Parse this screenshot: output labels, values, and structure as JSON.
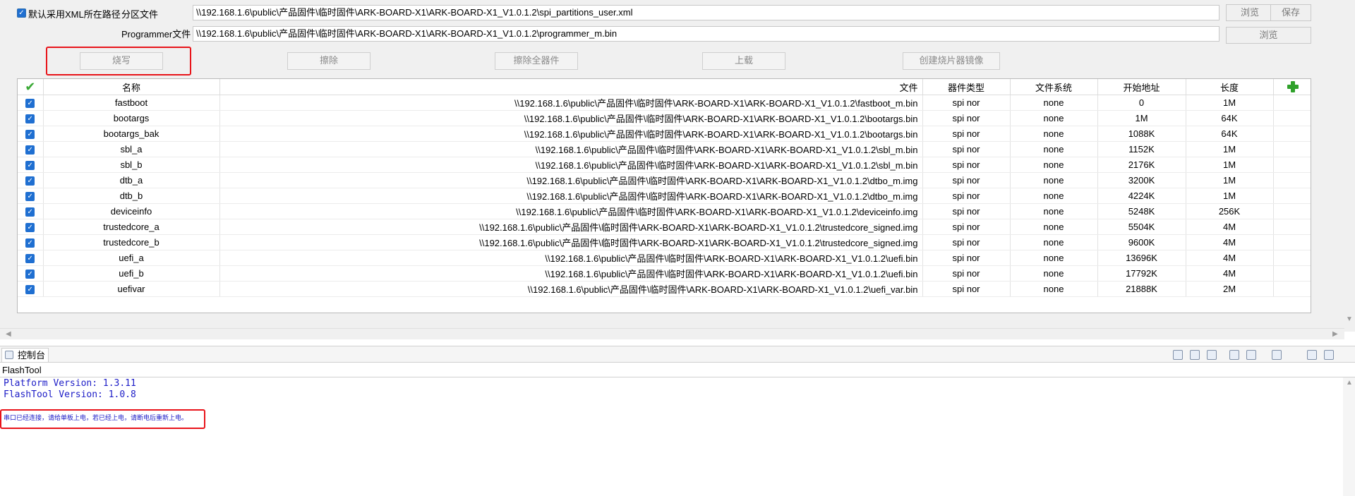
{
  "config": {
    "use_xml_path_label": "默认采用XML所在路径",
    "partition_label": "分区文件",
    "partition_path": "\\\\192.168.1.6\\public\\产品固件\\临时固件\\ARK-BOARD-X1\\ARK-BOARD-X1_V1.0.1.2\\spi_partitions_user.xml",
    "programmer_label": "Programmer文件",
    "programmer_path": "\\\\192.168.1.6\\public\\产品固件\\临时固件\\ARK-BOARD-X1\\ARK-BOARD-X1_V1.0.1.2\\programmer_m.bin",
    "browse_label": "浏览",
    "save_label": "保存",
    "browse2_label": "浏览"
  },
  "actions": {
    "flash": "烧写",
    "erase": "擦除",
    "erase_all": "擦除全器件",
    "upload": "上载",
    "create_image": "创建烧片器镜像"
  },
  "table": {
    "headers": {
      "name": "名称",
      "file": "文件",
      "device_type": "器件类型",
      "filesystem": "文件系统",
      "start_addr": "开始地址",
      "length": "长度"
    },
    "rows": [
      {
        "name": "fastboot",
        "file": "\\\\192.168.1.6\\public\\产品固件\\临时固件\\ARK-BOARD-X1\\ARK-BOARD-X1_V1.0.1.2\\fastboot_m.bin",
        "type": "spi nor",
        "fs": "none",
        "start": "0",
        "len": "1M"
      },
      {
        "name": "bootargs",
        "file": "\\\\192.168.1.6\\public\\产品固件\\临时固件\\ARK-BOARD-X1\\ARK-BOARD-X1_V1.0.1.2\\bootargs.bin",
        "type": "spi nor",
        "fs": "none",
        "start": "1M",
        "len": "64K"
      },
      {
        "name": "bootargs_bak",
        "file": "\\\\192.168.1.6\\public\\产品固件\\临时固件\\ARK-BOARD-X1\\ARK-BOARD-X1_V1.0.1.2\\bootargs.bin",
        "type": "spi nor",
        "fs": "none",
        "start": "1088K",
        "len": "64K"
      },
      {
        "name": "sbl_a",
        "file": "\\\\192.168.1.6\\public\\产品固件\\临时固件\\ARK-BOARD-X1\\ARK-BOARD-X1_V1.0.1.2\\sbl_m.bin",
        "type": "spi nor",
        "fs": "none",
        "start": "1152K",
        "len": "1M"
      },
      {
        "name": "sbl_b",
        "file": "\\\\192.168.1.6\\public\\产品固件\\临时固件\\ARK-BOARD-X1\\ARK-BOARD-X1_V1.0.1.2\\sbl_m.bin",
        "type": "spi nor",
        "fs": "none",
        "start": "2176K",
        "len": "1M"
      },
      {
        "name": "dtb_a",
        "file": "\\\\192.168.1.6\\public\\产品固件\\临时固件\\ARK-BOARD-X1\\ARK-BOARD-X1_V1.0.1.2\\dtbo_m.img",
        "type": "spi nor",
        "fs": "none",
        "start": "3200K",
        "len": "1M"
      },
      {
        "name": "dtb_b",
        "file": "\\\\192.168.1.6\\public\\产品固件\\临时固件\\ARK-BOARD-X1\\ARK-BOARD-X1_V1.0.1.2\\dtbo_m.img",
        "type": "spi nor",
        "fs": "none",
        "start": "4224K",
        "len": "1M"
      },
      {
        "name": "deviceinfo",
        "file": "\\\\192.168.1.6\\public\\产品固件\\临时固件\\ARK-BOARD-X1\\ARK-BOARD-X1_V1.0.1.2\\deviceinfo.img",
        "type": "spi nor",
        "fs": "none",
        "start": "5248K",
        "len": "256K"
      },
      {
        "name": "trustedcore_a",
        "file": "\\\\192.168.1.6\\public\\产品固件\\临时固件\\ARK-BOARD-X1\\ARK-BOARD-X1_V1.0.1.2\\trustedcore_signed.img",
        "type": "spi nor",
        "fs": "none",
        "start": "5504K",
        "len": "4M"
      },
      {
        "name": "trustedcore_b",
        "file": "\\\\192.168.1.6\\public\\产品固件\\临时固件\\ARK-BOARD-X1\\ARK-BOARD-X1_V1.0.1.2\\trustedcore_signed.img",
        "type": "spi nor",
        "fs": "none",
        "start": "9600K",
        "len": "4M"
      },
      {
        "name": "uefi_a",
        "file": "\\\\192.168.1.6\\public\\产品固件\\临时固件\\ARK-BOARD-X1\\ARK-BOARD-X1_V1.0.1.2\\uefi.bin",
        "type": "spi nor",
        "fs": "none",
        "start": "13696K",
        "len": "4M"
      },
      {
        "name": "uefi_b",
        "file": "\\\\192.168.1.6\\public\\产品固件\\临时固件\\ARK-BOARD-X1\\ARK-BOARD-X1_V1.0.1.2\\uefi.bin",
        "type": "spi nor",
        "fs": "none",
        "start": "17792K",
        "len": "4M"
      },
      {
        "name": "uefivar",
        "file": "\\\\192.168.1.6\\public\\产品固件\\临时固件\\ARK-BOARD-X1\\ARK-BOARD-X1_V1.0.1.2\\uefi_var.bin",
        "type": "spi nor",
        "fs": "none",
        "start": "21888K",
        "len": "2M"
      }
    ]
  },
  "console": {
    "tab_label": "控制台",
    "sub_title": "FlashTool",
    "lines": [
      "Platform Version: 1.3.11",
      "FlashTool Version: 1.0.8"
    ],
    "message": "串口已经连接，请给单板上电，若已经上电，请断电后重新上电。"
  },
  "colors": {
    "accent": "#1f6fd1",
    "highlight": "#e8141a",
    "console_text": "#1c1cc7",
    "green": "#2fa12a"
  },
  "icons": [
    "checkbox-checked-icon",
    "green-check-icon",
    "green-plus-icon",
    "console-icon",
    "scroll-arrow-icon"
  ]
}
